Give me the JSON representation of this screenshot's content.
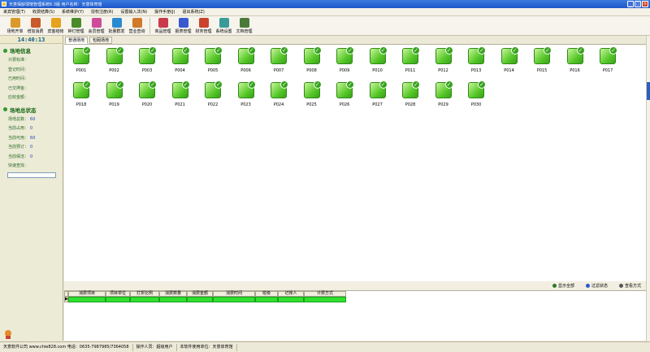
{
  "window": {
    "title": "天意保龄球馆管理系统6.3版    用户名称：天意体育馆"
  },
  "menu": [
    "来宾管理(T)",
    "收费结算(S)",
    "系统维护(Y)",
    "授权注册(R)",
    "设置输入法(N)",
    "操作手册(J)",
    "退出系统(Z)"
  ],
  "toolbar": [
    {
      "label": "场地开单",
      "icon": "venue-open-icon",
      "color": "#d99a2a"
    },
    {
      "label": "增加消费",
      "icon": "add-consumption-icon",
      "color": "#c95a2a"
    },
    {
      "label": "宾客结帐",
      "icon": "checkout-icon",
      "color": "#e6a21c"
    },
    {
      "label": "钟灯管理",
      "icon": "clock-light-icon",
      "color": "#4a8a2a"
    },
    {
      "label": "会员管理",
      "icon": "member-icon",
      "color": "#d04a9a"
    },
    {
      "label": "批量群发",
      "icon": "broadcast-icon",
      "color": "#2a8ad0"
    },
    {
      "label": "营业查询",
      "icon": "business-query-icon",
      "color": "#d07a2a"
    },
    {
      "label": "商品管理",
      "icon": "goods-icon",
      "color": "#c93a4a"
    },
    {
      "label": "报表管理",
      "icon": "report-icon",
      "color": "#3a5ad0"
    },
    {
      "label": "财务管理",
      "icon": "finance-icon",
      "color": "#c9442a"
    },
    {
      "label": "系统设置",
      "icon": "settings-icon",
      "color": "#3a9a9a"
    },
    {
      "label": "文档管理",
      "icon": "document-icon",
      "color": "#4a7a3a"
    }
  ],
  "sidebar": {
    "clock": "14:40:13",
    "venue_info": {
      "title": "场地信息",
      "rows": [
        {
          "label": "计费标准："
        },
        {
          "label": "登记时间："
        },
        {
          "label": "已用时间："
        },
        {
          "label": "已交押金："
        },
        {
          "label": "应收金额："
        }
      ]
    },
    "venue_status": {
      "title": "场地总状态",
      "rows": [
        {
          "label": "场地总数：",
          "value": "60"
        },
        {
          "label": "当前占用：",
          "value": "0"
        },
        {
          "label": "当前可用：",
          "value": "60"
        },
        {
          "label": "当前预订：",
          "value": "0"
        },
        {
          "label": "当前保洁：",
          "value": "0"
        },
        {
          "label": "快速查找："
        }
      ]
    }
  },
  "tabs": [
    "普通场地",
    "包厢场地"
  ],
  "venues": [
    "P001",
    "P002",
    "P003",
    "P004",
    "P005",
    "P006",
    "P007",
    "P008",
    "P009",
    "P010",
    "P011",
    "P012",
    "P013",
    "P014",
    "P015",
    "P016",
    "P017",
    "P018",
    "P019",
    "P020",
    "P021",
    "P022",
    "P023",
    "P024",
    "P025",
    "P026",
    "P027",
    "P028",
    "P029",
    "P030"
  ],
  "actions": [
    {
      "label": "显示全部",
      "color": "#2a7a2a"
    },
    {
      "label": "过滤状态",
      "color": "#2a5ad0"
    },
    {
      "label": "查看方式",
      "color": "#555555"
    }
  ],
  "table": {
    "columns": [
      "消费项目",
      "项目单位",
      "打折比例",
      "消费数量",
      "消费金额",
      "消费时间",
      "班级",
      "记账人",
      "计费方式"
    ]
  },
  "statusbar": [
    "天意软件公司 www.chie828.com 电话：0635-7987985/7364058",
    "操作人员：超级用户",
    "本软件使用单位：天意体育馆"
  ]
}
